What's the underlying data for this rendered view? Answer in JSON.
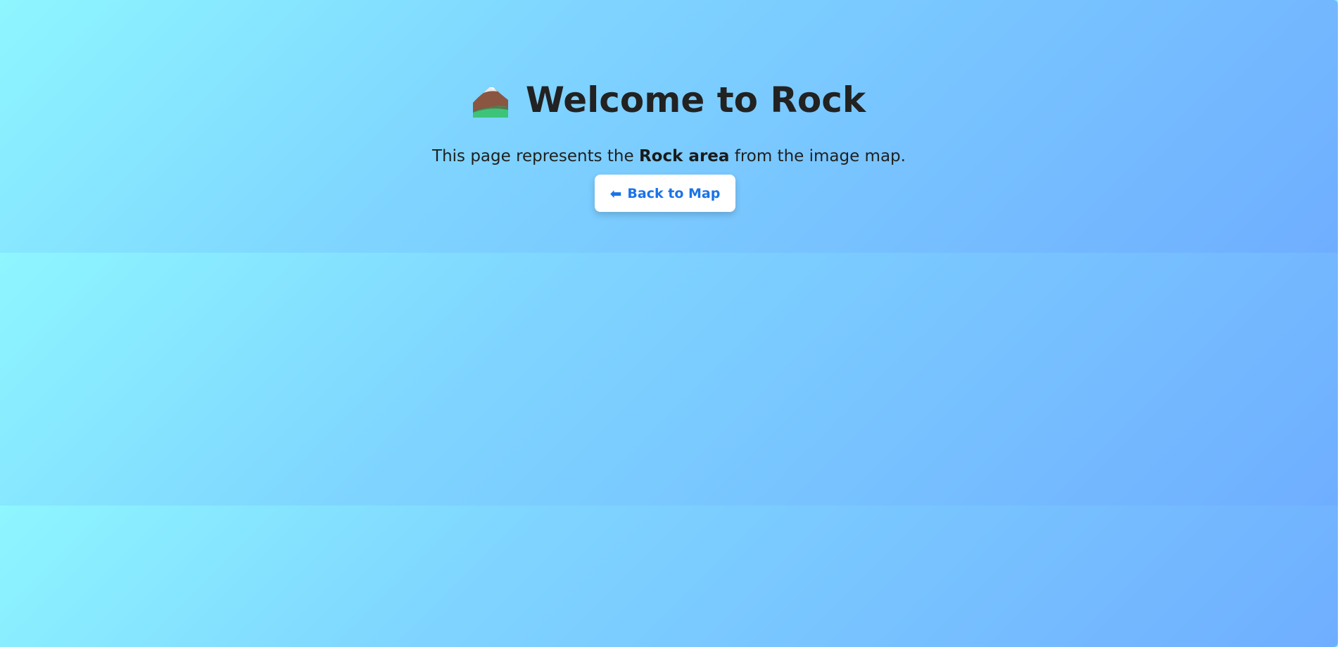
{
  "page": {
    "title": "Welcome to Rock",
    "icon": "mountain-icon",
    "description_prefix": "This page represents the ",
    "description_bold": "Rock area",
    "description_suffix": " from the image map."
  },
  "actions": {
    "back_arrow": "⬅",
    "back_label": "Back to Map"
  },
  "colors": {
    "gradient_start": "#8ef6ff",
    "gradient_end": "#6faeff",
    "button_text": "#1a73e8"
  }
}
